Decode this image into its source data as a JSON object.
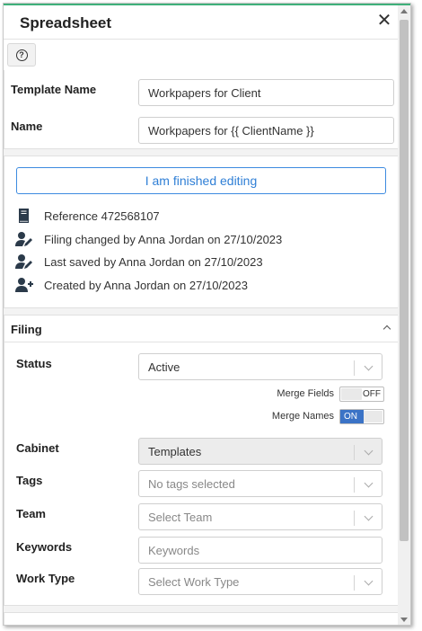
{
  "header": {
    "title": "Spreadsheet",
    "close_icon": "close-icon"
  },
  "toolbar": {
    "help_icon": "question-circle-icon",
    "help_glyph": "?"
  },
  "form": {
    "template_name_label": "Template Name",
    "template_name_value": "Workpapers for Client",
    "name_label": "Name",
    "name_value": "Workpapers for {{ ClientName }}"
  },
  "info": {
    "finish_button": "I am finished editing",
    "reference": "Reference 472568107",
    "filing_changed": "Filing changed by Anna Jordan on 27/10/2023",
    "last_saved": "Last saved by Anna Jordan on 27/10/2023",
    "created": "Created by Anna Jordan on 27/10/2023"
  },
  "filing": {
    "section_title": "Filing",
    "status_label": "Status",
    "status_value": "Active",
    "merge_fields_label": "Merge Fields",
    "merge_fields_state": "OFF",
    "merge_names_label": "Merge Names",
    "merge_names_state": "ON",
    "cabinet_label": "Cabinet",
    "cabinet_value": "Templates",
    "tags_label": "Tags",
    "tags_placeholder": "No tags selected",
    "team_label": "Team",
    "team_placeholder": "Select Team",
    "keywords_label": "Keywords",
    "keywords_placeholder": "Keywords",
    "work_type_label": "Work Type",
    "work_type_placeholder": "Select Work Type"
  },
  "colors": {
    "accent": "#3fb07a",
    "primary": "#2f7fd6",
    "toggle_on": "#3b73c6",
    "icon": "#2b3a4a"
  }
}
